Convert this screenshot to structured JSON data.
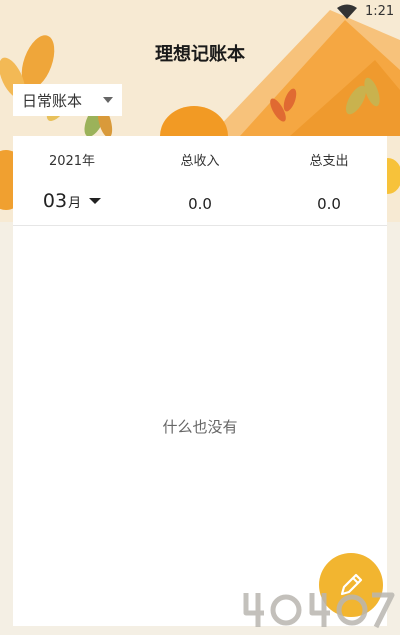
{
  "status_bar": {
    "time": "1:21",
    "wifi_icon": "wifi-icon"
  },
  "header": {
    "title": "理想记账本"
  },
  "book_selector": {
    "selected": "日常账本",
    "caret_icon": "caret-down-icon"
  },
  "summary": {
    "year_label": "2021年",
    "month_number": "03",
    "month_unit": "月",
    "income_label": "总收入",
    "income_value": "0.0",
    "expense_label": "总支出",
    "expense_value": "0.0"
  },
  "list": {
    "empty_text": "什么也没有"
  },
  "fab": {
    "icon": "pencil-icon",
    "color": "#f2b530"
  },
  "colors": {
    "background": "#f4efe4",
    "accent_orange": "#f2a23a",
    "card": "#ffffff"
  }
}
